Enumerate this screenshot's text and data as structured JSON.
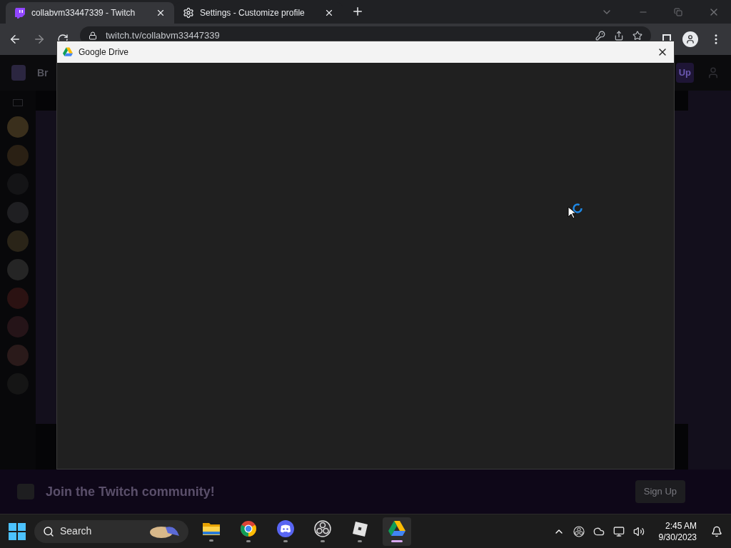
{
  "browser": {
    "tabs": [
      {
        "title": "collabvm33447339 - Twitch",
        "kind": "twitch",
        "selected": true
      },
      {
        "title": "Settings - Customize profile",
        "kind": "settings",
        "selected": false
      }
    ],
    "address": "twitch.tv/collabvm33447339"
  },
  "page": {
    "nav_text": "Br",
    "nav_button": "Up",
    "banner": {
      "text": "Join the Twitch community!",
      "button": "Sign Up"
    }
  },
  "dialog": {
    "title": "Google Drive",
    "loading": true
  },
  "taskbar": {
    "search": "Search",
    "apps": [
      {
        "kind": "files",
        "selected": false
      },
      {
        "kind": "chrome",
        "selected": false
      },
      {
        "kind": "discord",
        "selected": false
      },
      {
        "kind": "obs",
        "selected": false
      },
      {
        "kind": "roblox",
        "selected": false
      },
      {
        "kind": "drive",
        "selected": true
      }
    ],
    "time": "2:45 AM",
    "date": "9/30/2023"
  }
}
